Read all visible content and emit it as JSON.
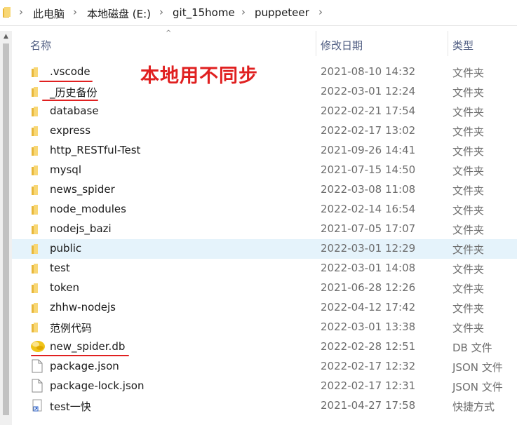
{
  "breadcrumb": [
    "此电脑",
    "本地磁盘 (E:)",
    "git_15home",
    "puppeteer"
  ],
  "columns": {
    "name": "名称",
    "date": "修改日期",
    "type": "类型"
  },
  "annotation": "本地用不同步",
  "files": [
    {
      "name": ".vscode",
      "date": "2021-08-10 14:32",
      "type": "文件夹",
      "icon": "folder-icon"
    },
    {
      "name": "_历史备份",
      "date": "2022-03-01 12:24",
      "type": "文件夹",
      "icon": "folder-icon"
    },
    {
      "name": "database",
      "date": "2022-02-21 17:54",
      "type": "文件夹",
      "icon": "folder-icon"
    },
    {
      "name": "express",
      "date": "2022-02-17 13:02",
      "type": "文件夹",
      "icon": "folder-icon"
    },
    {
      "name": "http_RESTful-Test",
      "date": "2021-09-26 14:41",
      "type": "文件夹",
      "icon": "folder-icon"
    },
    {
      "name": "mysql",
      "date": "2021-07-15 14:50",
      "type": "文件夹",
      "icon": "folder-icon"
    },
    {
      "name": "news_spider",
      "date": "2022-03-08 11:08",
      "type": "文件夹",
      "icon": "folder-icon"
    },
    {
      "name": "node_modules",
      "date": "2022-02-14 16:54",
      "type": "文件夹",
      "icon": "folder-icon"
    },
    {
      "name": "nodejs_bazi",
      "date": "2021-07-05 17:07",
      "type": "文件夹",
      "icon": "folder-icon"
    },
    {
      "name": "public",
      "date": "2022-03-01 12:29",
      "type": "文件夹",
      "icon": "folder-icon",
      "selected": true
    },
    {
      "name": "test",
      "date": "2022-03-01 14:08",
      "type": "文件夹",
      "icon": "folder-icon"
    },
    {
      "name": "token",
      "date": "2021-06-28 12:26",
      "type": "文件夹",
      "icon": "folder-icon"
    },
    {
      "name": "zhhw-nodejs",
      "date": "2022-04-12 17:42",
      "type": "文件夹",
      "icon": "folder-icon"
    },
    {
      "name": "范例代码",
      "date": "2022-03-01 13:38",
      "type": "文件夹",
      "icon": "folder-icon"
    },
    {
      "name": "new_spider.db",
      "date": "2022-02-28 12:51",
      "type": "DB 文件",
      "icon": "database-file-icon"
    },
    {
      "name": "package.json",
      "date": "2022-02-17 12:32",
      "type": "JSON 文件",
      "icon": "document-icon"
    },
    {
      "name": "package-lock.json",
      "date": "2022-02-17 12:31",
      "type": "JSON 文件",
      "icon": "document-icon"
    },
    {
      "name": "test一快",
      "date": "2021-04-27 17:58",
      "type": "快捷方式",
      "icon": "shortcut-icon"
    }
  ]
}
